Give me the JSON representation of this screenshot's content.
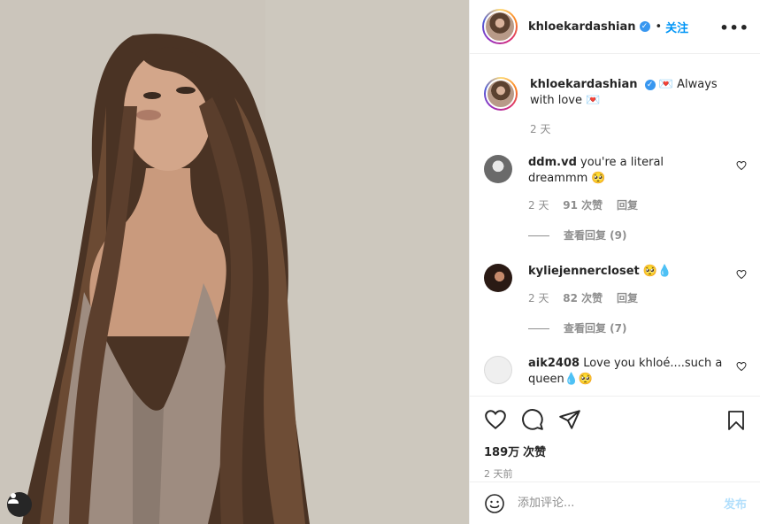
{
  "header": {
    "username": "khloekardashian",
    "verified_mark": "✓",
    "separator": "•",
    "follow_label": "关注",
    "more_label": "•••"
  },
  "caption": {
    "username": "khloekardashian",
    "text": "💌 Always with love 💌",
    "time": "2 天"
  },
  "comments": [
    {
      "username": "ddm.vd",
      "text": "you're a literal dreammm 🥺",
      "time": "2 天",
      "likes": "91 次赞",
      "reply": "回复",
      "view_replies": "查看回复 (9)"
    },
    {
      "username": "kyliejennercloset",
      "text": "🥺💧",
      "time": "2 天",
      "likes": "82 次赞",
      "reply": "回复",
      "view_replies": "查看回复 (7)"
    },
    {
      "username": "aik2408",
      "text": "Love you khloé....such a queen💧🥺"
    }
  ],
  "stats": {
    "likes_count": "189万",
    "likes_label": "次赞",
    "posted": "2 天前"
  },
  "add_comment": {
    "placeholder": "添加评论...",
    "post_label": "发布"
  },
  "colors": {
    "accent": "#0095f6",
    "muted": "#8e8e8e",
    "border": "#efefef"
  },
  "icons": [
    "user-tag-icon",
    "verified-badge-icon",
    "more-options-icon",
    "heart-icon",
    "comment-icon",
    "share-icon",
    "bookmark-icon",
    "emoji-icon"
  ]
}
